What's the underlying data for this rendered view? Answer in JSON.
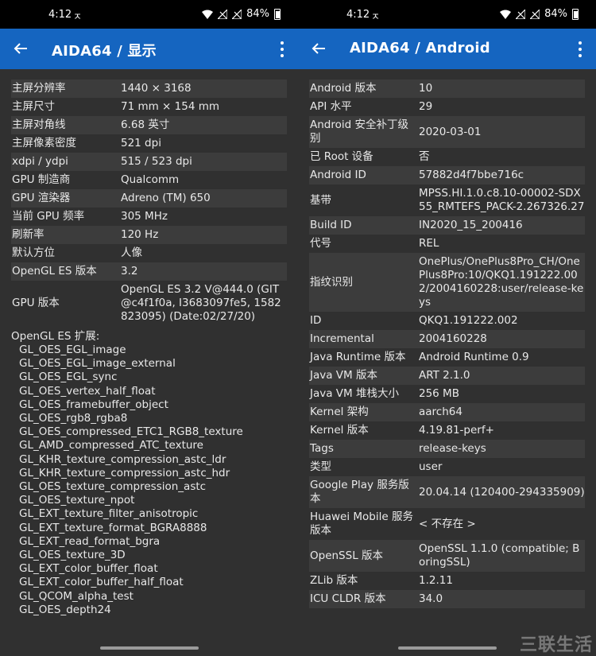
{
  "colors": {
    "appbar": "#1565c0",
    "background": "#303030",
    "row_alt": "#3c3c3c",
    "statusbar": "#000000"
  },
  "left": {
    "status": {
      "time": "4:12",
      "battery": "84%"
    },
    "appbar": {
      "title": "AIDA64  /  显示",
      "back_icon": "arrow-left-icon",
      "menu_icon": "more-vert-icon"
    },
    "rows": [
      {
        "k": "主屏分辨率",
        "v": "1440 × 3168"
      },
      {
        "k": "主屏尺寸",
        "v": "71 mm × 154 mm"
      },
      {
        "k": "主屏对角线",
        "v": "6.68 英寸"
      },
      {
        "k": "主屏像素密度",
        "v": "521 dpi"
      },
      {
        "k": "xdpi / ydpi",
        "v": "515 / 523 dpi"
      },
      {
        "k": "GPU 制造商",
        "v": "Qualcomm"
      },
      {
        "k": "GPU 渲染器",
        "v": "Adreno (TM) 650"
      },
      {
        "k": "当前 GPU 频率",
        "v": "305 MHz"
      },
      {
        "k": "刷新率",
        "v": "120 Hz"
      },
      {
        "k": "默认方位",
        "v": "人像"
      },
      {
        "k": "OpenGL ES 版本",
        "v": "3.2"
      },
      {
        "k": "GPU 版本",
        "v": "OpenGL ES 3.2 V@444.0 (GIT@c4f1f0a, I3683097fe5, 1582823095) (Date:02/27/20)"
      }
    ],
    "ext_title": "OpenGL ES 扩展:",
    "extensions": [
      "GL_OES_EGL_image",
      "GL_OES_EGL_image_external",
      "GL_OES_EGL_sync",
      "GL_OES_vertex_half_float",
      "GL_OES_framebuffer_object",
      "GL_OES_rgb8_rgba8",
      "GL_OES_compressed_ETC1_RGB8_texture",
      "GL_AMD_compressed_ATC_texture",
      "GL_KHR_texture_compression_astc_ldr",
      "GL_KHR_texture_compression_astc_hdr",
      "GL_OES_texture_compression_astc",
      "GL_OES_texture_npot",
      "GL_EXT_texture_filter_anisotropic",
      "GL_EXT_texture_format_BGRA8888",
      "GL_EXT_read_format_bgra",
      "GL_OES_texture_3D",
      "GL_EXT_color_buffer_float",
      "GL_EXT_color_buffer_half_float",
      "GL_QCOM_alpha_test",
      "GL_OES_depth24"
    ]
  },
  "right": {
    "status": {
      "time": "4:12",
      "battery": "84%"
    },
    "appbar": {
      "title": "AIDA64  /  Android",
      "back_icon": "arrow-left-icon",
      "menu_icon": "more-vert-icon"
    },
    "rows": [
      {
        "k": "Android 版本",
        "v": "10"
      },
      {
        "k": "API 水平",
        "v": "29"
      },
      {
        "k": "Android 安全补丁级别",
        "v": "2020-03-01"
      },
      {
        "k": "已 Root 设备",
        "v": "否"
      },
      {
        "k": "Android ID",
        "v": "57882d4f7bbe716c"
      },
      {
        "k": "基带",
        "v": "MPSS.HI.1.0.c8.10-00002-SDX55_RMTEFS_PACK-2.267326.27"
      },
      {
        "k": "Build ID",
        "v": "IN2020_15_200416"
      },
      {
        "k": "代号",
        "v": "REL"
      },
      {
        "k": "指纹识别",
        "v": "OnePlus/OnePlus8Pro_CH/OnePlus8Pro:10/QKQ1.191222.002/2004160228:user/release-keys"
      },
      {
        "k": "ID",
        "v": "QKQ1.191222.002"
      },
      {
        "k": "Incremental",
        "v": "2004160228"
      },
      {
        "k": "Java Runtime 版本",
        "v": "Android Runtime 0.9"
      },
      {
        "k": "Java VM 版本",
        "v": "ART 2.1.0"
      },
      {
        "k": "Java VM 堆栈大小",
        "v": "256 MB"
      },
      {
        "k": "Kernel 架构",
        "v": "aarch64"
      },
      {
        "k": "Kernel 版本",
        "v": "4.19.81-perf+"
      },
      {
        "k": "Tags",
        "v": "release-keys"
      },
      {
        "k": "类型",
        "v": "user"
      },
      {
        "k": "Google Play 服务版本",
        "v": "20.04.14 (120400-294335909)"
      },
      {
        "k": "Huawei Mobile 服务版本",
        "v": "< 不存在 >"
      },
      {
        "k": "OpenSSL 版本",
        "v": "OpenSSL 1.1.0 (compatible; BoringSSL)"
      },
      {
        "k": "ZLib 版本",
        "v": "1.2.11"
      },
      {
        "k": "ICU CLDR 版本",
        "v": "34.0"
      }
    ]
  },
  "watermark": "三联生活"
}
